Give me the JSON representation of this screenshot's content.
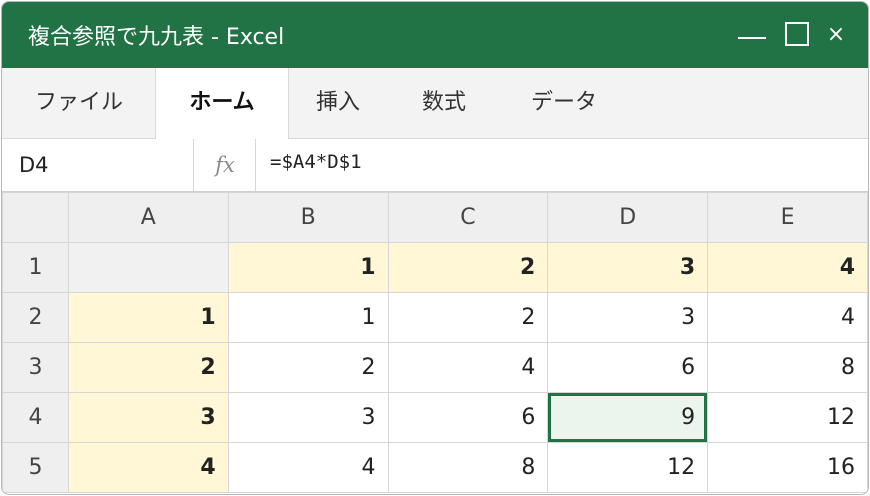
{
  "window": {
    "title": "複合参照で九九表 - Excel"
  },
  "title_controls": {
    "minimize": "—",
    "close": "×"
  },
  "ribbon": {
    "tabs": [
      {
        "label": "ファイル",
        "active": false
      },
      {
        "label": "ホーム",
        "active": true
      },
      {
        "label": "挿入",
        "active": false
      },
      {
        "label": "数式",
        "active": false
      },
      {
        "label": "データ",
        "active": false
      }
    ]
  },
  "formula_bar": {
    "name_box": "D4",
    "fx": "fx",
    "formula": "=$A4*D$1"
  },
  "sheet": {
    "columns": [
      "A",
      "B",
      "C",
      "D",
      "E"
    ],
    "rows": [
      {
        "num": "1",
        "cells": [
          "",
          "1",
          "2",
          "3",
          "4"
        ]
      },
      {
        "num": "2",
        "cells": [
          "1",
          "1",
          "2",
          "3",
          "4"
        ]
      },
      {
        "num": "3",
        "cells": [
          "2",
          "2",
          "4",
          "6",
          "8"
        ]
      },
      {
        "num": "4",
        "cells": [
          "3",
          "3",
          "6",
          "9",
          "12"
        ]
      },
      {
        "num": "5",
        "cells": [
          "4",
          "4",
          "8",
          "12",
          "16"
        ]
      }
    ],
    "selected_cell": "D4"
  },
  "colors": {
    "brand": "#217346",
    "header_fill": "#fff7d6",
    "selected_fill": "#ecf4ee"
  }
}
